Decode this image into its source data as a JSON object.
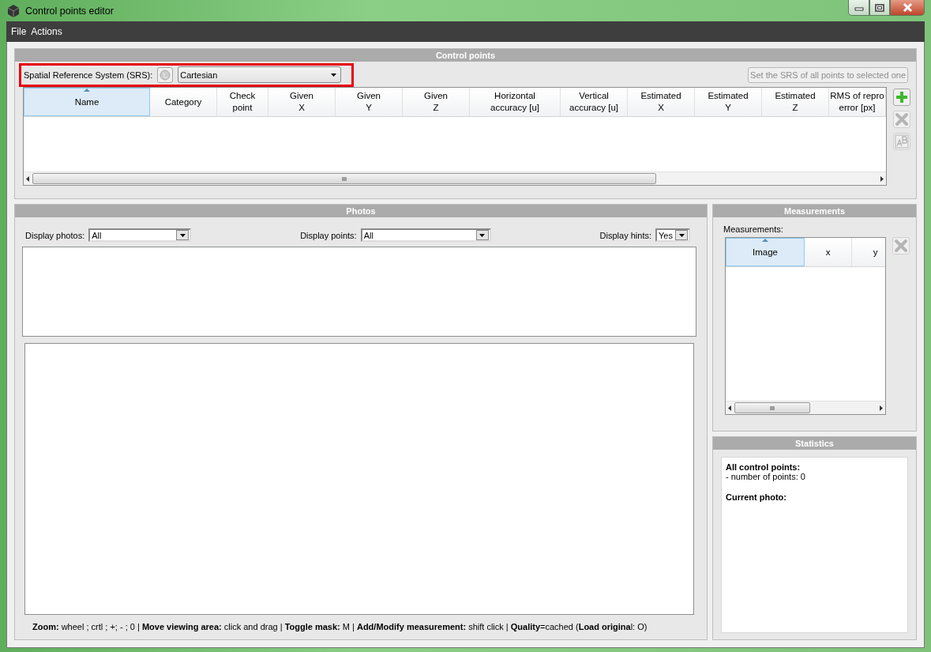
{
  "window": {
    "title": "Control points editor"
  },
  "menu": [
    {
      "label": "File"
    },
    {
      "label": "Actions"
    }
  ],
  "control_points": {
    "title": "Control points",
    "srs_label": "Spatial Reference System (SRS):",
    "srs_value": "Cartesian",
    "set_srs_button": "Set the SRS of all points to selected one",
    "set_srs_disabled": true,
    "columns": [
      {
        "label": "Name",
        "sorted": true
      },
      {
        "label": "Category",
        "sorted": false
      },
      {
        "label": "Check\npoint",
        "sorted": false
      },
      {
        "label": "Given\nX",
        "sorted": false
      },
      {
        "label": "Given\nY",
        "sorted": false
      },
      {
        "label": "Given\nZ",
        "sorted": false
      },
      {
        "label": "Horizontal\naccuracy [u]",
        "sorted": false
      },
      {
        "label": "Vertical\naccuracy [u]",
        "sorted": false
      },
      {
        "label": "Estimated\nX",
        "sorted": false
      },
      {
        "label": "Estimated\nY",
        "sorted": false
      },
      {
        "label": "Estimated\nZ",
        "sorted": false
      },
      {
        "label": "RMS of repro\nerror [px]",
        "sorted": false
      }
    ],
    "side_buttons": [
      {
        "kind": "add",
        "disabled": false
      },
      {
        "kind": "remove",
        "disabled": true
      },
      {
        "kind": "rename",
        "disabled": true
      }
    ]
  },
  "photos": {
    "title": "Photos",
    "filters": [
      {
        "label": "Display photos:",
        "value": "All"
      },
      {
        "label": "Display points:",
        "value": "All"
      },
      {
        "label": "Display hints:",
        "value": "Yes"
      }
    ],
    "help": "**Zoom:** wheel ; crtl ; +; - ; 0 | **Move viewing area:** click and drag |  **Toggle mask:** M |  **Add/Modify measurement:** shift click |  **Quality**=cached (**Load origina**l: O)"
  },
  "measurements": {
    "title": "Measurements",
    "label": "Measurements:",
    "columns": [
      {
        "label": "Image",
        "sorted": true
      },
      {
        "label": "x",
        "sorted": false
      },
      {
        "label": "y",
        "sorted": false
      }
    ],
    "remove_disabled": true
  },
  "statistics": {
    "title": "Statistics",
    "sections": [
      {
        "heading": "All control points:",
        "lines": [
          "- number of points: 0"
        ]
      },
      {
        "heading": "Current photo:"
      }
    ]
  }
}
